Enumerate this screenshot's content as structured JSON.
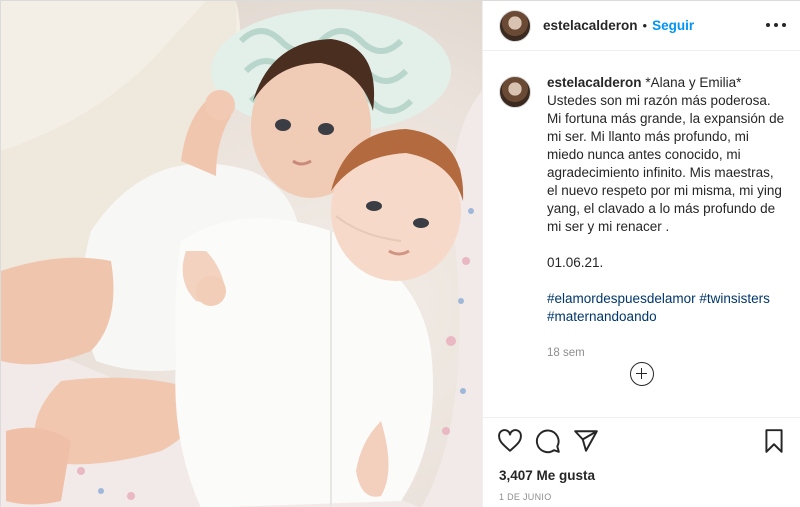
{
  "post": {
    "author": {
      "username": "estelacalderon",
      "follow_label": "Seguir",
      "avatar_icon": "profile-avatar"
    },
    "caption": {
      "username": "estelacalderon",
      "lines": [
        "*Alana y Emilia*",
        "Ustedes son mi razón más poderosa. Mi fortuna más grande, la expansión de mi ser. Mi llanto más profundo, mi miedo nunca antes conocido, mi agradecimiento infinito. Mis maestras, el nuevo respeto por mi misma, mi ying yang, el clavado a lo más profundo de mi ser y mi renacer ."
      ],
      "date_text": "01.06.21.",
      "hashtags": [
        "#elamordespuesdelamor",
        "#twinsisters",
        "#maternandoando"
      ],
      "age": "18 sem"
    },
    "icons": {
      "more": "more-options-icon",
      "like": "heart-icon",
      "comment": "comment-icon",
      "share": "share-icon",
      "save": "bookmark-icon",
      "load_more": "plus-circle-icon"
    },
    "likes_text": "3,407 Me gusta",
    "posted_date": "1 DE JUNIO",
    "colors": {
      "link_blue": "#0095f6",
      "hashtag_blue": "#00376b",
      "text": "#262626",
      "muted": "#8e8e8e",
      "border": "#dbdbdb"
    }
  }
}
